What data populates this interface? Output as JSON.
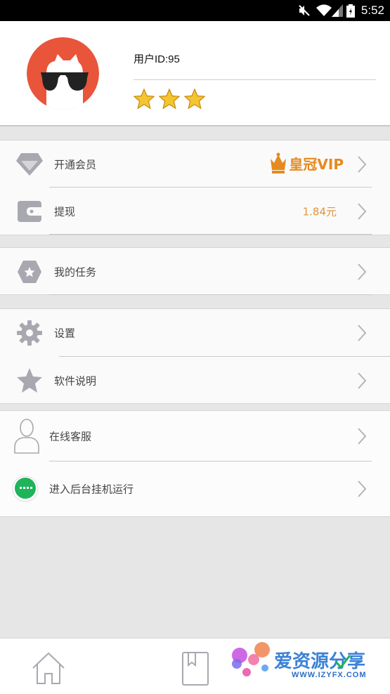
{
  "status_bar": {
    "time": "5:52"
  },
  "profile": {
    "user_id": "用户ID:95",
    "star_count": 3
  },
  "menu": {
    "vip": {
      "label": "开通会员",
      "badge": "皇冠VIP"
    },
    "withdraw": {
      "label": "提现",
      "value": "1.84元"
    },
    "tasks": {
      "label": "我的任务"
    },
    "settings": {
      "label": "设置"
    },
    "manual": {
      "label": "软件说明"
    },
    "support": {
      "label": "在线客服"
    },
    "background": {
      "label": "进入后台挂机运行"
    }
  },
  "watermark": {
    "title": "爱资源分享",
    "url": "WWW.IZYFX.COM"
  },
  "colors": {
    "accent_orange": "#e0963a",
    "icon_gray": "#a8a8b0",
    "green": "#1fb35a",
    "avatar_red": "#e8553a"
  }
}
